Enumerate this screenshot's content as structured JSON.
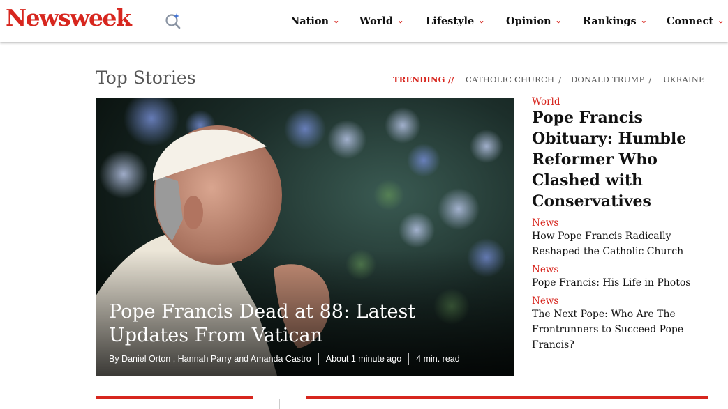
{
  "header": {
    "logo": "Newsweek",
    "search_icon": "search-sparkle-icon",
    "nav": [
      {
        "label": "Nation"
      },
      {
        "label": "World"
      },
      {
        "label": "Lifestyle"
      },
      {
        "label": "Opinion"
      },
      {
        "label": "Rankings"
      },
      {
        "label": "Connect"
      }
    ]
  },
  "top_stories": {
    "title": "Top Stories",
    "trending_label": "TRENDING //",
    "topics": [
      "CATHOLIC CHURCH",
      "DONALD TRUMP",
      "UKRAINE"
    ],
    "topic_separator": "/"
  },
  "hero": {
    "title": "Pope Francis Dead at 88: Latest Updates From Vatican",
    "byline": "By Daniel Orton , Hannah Parry and Amanda Castro",
    "time": "About 1 minute ago",
    "read_time": "4 min. read"
  },
  "side": {
    "lead": {
      "category": "World",
      "title": "Pope Francis Obituary: Humble Reformer Who Clashed with Conservatives"
    },
    "items": [
      {
        "category": "News",
        "title": "How Pope Francis Radically Reshaped the Catholic Church"
      },
      {
        "category": "News",
        "title": "Pope Francis: His Life in Photos"
      },
      {
        "category": "News",
        "title": "The Next Pope: Who Are The Frontrunners to Succeed Pope Francis?"
      }
    ]
  },
  "colors": {
    "brand_red": "#d7261e",
    "text": "#111111",
    "muted": "#555555"
  }
}
